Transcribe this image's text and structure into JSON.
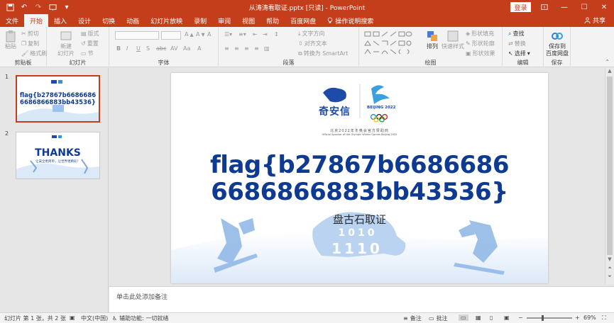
{
  "app": {
    "title": "从涛涛看取证.pptx [只读] - PowerPoint",
    "login_label": "登录",
    "share_label": "共享"
  },
  "tabs": [
    {
      "label": "文件"
    },
    {
      "label": "开始"
    },
    {
      "label": "插入"
    },
    {
      "label": "设计"
    },
    {
      "label": "切换"
    },
    {
      "label": "动画"
    },
    {
      "label": "幻灯片放映"
    },
    {
      "label": "录制"
    },
    {
      "label": "审阅"
    },
    {
      "label": "视图"
    },
    {
      "label": "帮助"
    },
    {
      "label": "百度网盘"
    },
    {
      "label": "操作说明搜索"
    }
  ],
  "ribbon": {
    "clipboard": {
      "label": "剪贴板",
      "paste": "粘贴",
      "cut": "剪切",
      "copy": "复制",
      "format_painter": "格式刷"
    },
    "slides": {
      "label": "幻灯片",
      "new_slide": "新建\n幻灯片",
      "layout": "版式",
      "reset": "重置",
      "section": "节"
    },
    "font": {
      "label": "字体"
    },
    "paragraph": {
      "label": "段落",
      "text_direction": "文字方向",
      "align_text": "对齐文本",
      "smartart": "转换为 SmartArt"
    },
    "drawing": {
      "label": "绘图",
      "arrange": "排列",
      "quick_styles": "快速样式",
      "shape_fill": "形状填充",
      "shape_outline": "形状轮廓",
      "shape_effects": "形状效果"
    },
    "editing": {
      "label": "编辑",
      "find": "查找",
      "replace": "替换",
      "select": "选择"
    },
    "save": {
      "label": "保存",
      "save_to_baidu": "保存到\n百度网盘"
    }
  },
  "thumbnails": [
    {
      "number": "1",
      "flag_text": "flag{b27867b6686686\n6686866883bb43536}"
    },
    {
      "number": "2",
      "thanks": "THANKS",
      "subtitle": "让安全更简单，让世界更精彩！"
    }
  ],
  "slide": {
    "brand_cn": "奇安信",
    "beijing": "BEIJING 2022",
    "sponsor_cn": "北京2022年冬奥会官方赞助商",
    "sponsor_en": "Official Sponsor of the Olympic Winter Games Beijing 2022",
    "flag_line1": "flag{b27867b6686686",
    "flag_line2": "6686866883bb43536}",
    "subtitle": "盘古石取证",
    "binary_top": "1010",
    "binary_bottom": "1110"
  },
  "notes_placeholder": "单击此处添加备注",
  "status": {
    "slide_info": "幻灯片 第 1 张，共 2 张",
    "language": "中文(中国)",
    "accessibility": "辅助功能: 一切就绪",
    "notes": "备注",
    "comments": "批注",
    "zoom": "69%"
  },
  "colors": {
    "accent": "#c43e1c",
    "flag_blue": "#0e3a92"
  },
  "zoom_level": 0.69
}
